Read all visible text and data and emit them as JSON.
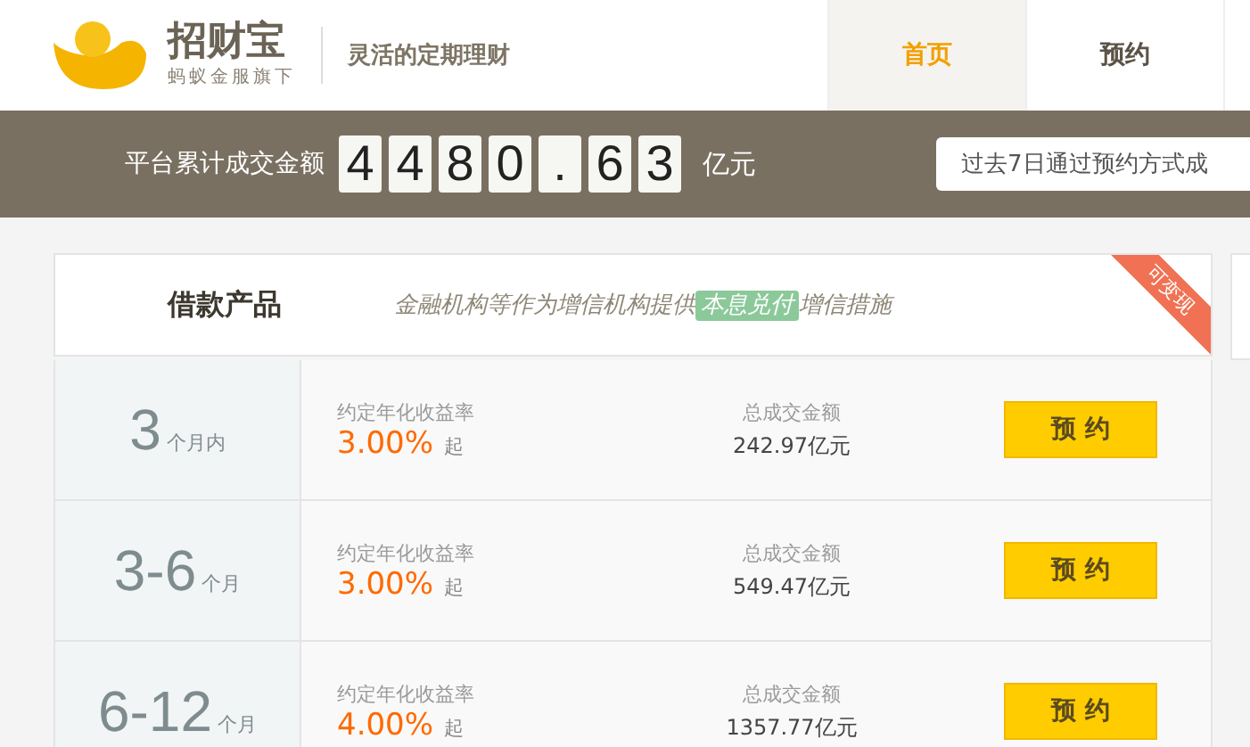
{
  "header": {
    "brand": "招财宝",
    "brand_sub": "蚂蚁金服旗下",
    "slogan": "灵活的定期理财",
    "nav": [
      {
        "label": "首页",
        "selected": true
      },
      {
        "label": "预约",
        "selected": false
      }
    ]
  },
  "banner": {
    "label": "平台累计成交金额",
    "digits": [
      "4",
      "4",
      "8",
      "0",
      ".",
      "6",
      "3"
    ],
    "unit": "亿元",
    "notice": "过去7日通过预约方式成"
  },
  "products": {
    "title": "借款产品",
    "tagline_before": "金融机构等作为增信机构提供",
    "tagline_highlight": "本息兑付",
    "tagline_after": "增信措施",
    "ribbon": "可变现",
    "rows": [
      {
        "term": "3",
        "term_unit": "个月内",
        "rate_label": "约定年化收益率",
        "rate": "3.00%",
        "rate_suffix": "起",
        "total_label": "总成交金额",
        "total": "242.97亿元",
        "button": "预 约"
      },
      {
        "term": "3-6",
        "term_unit": "个月",
        "rate_label": "约定年化收益率",
        "rate": "3.00%",
        "rate_suffix": "起",
        "total_label": "总成交金额",
        "total": "549.47亿元",
        "button": "预 约"
      },
      {
        "term": "6-12",
        "term_unit": "个月",
        "rate_label": "约定年化收益率",
        "rate": "4.00%",
        "rate_suffix": "起",
        "total_label": "总成交金额",
        "total": "1357.77亿元",
        "button": "预 约"
      }
    ]
  }
}
